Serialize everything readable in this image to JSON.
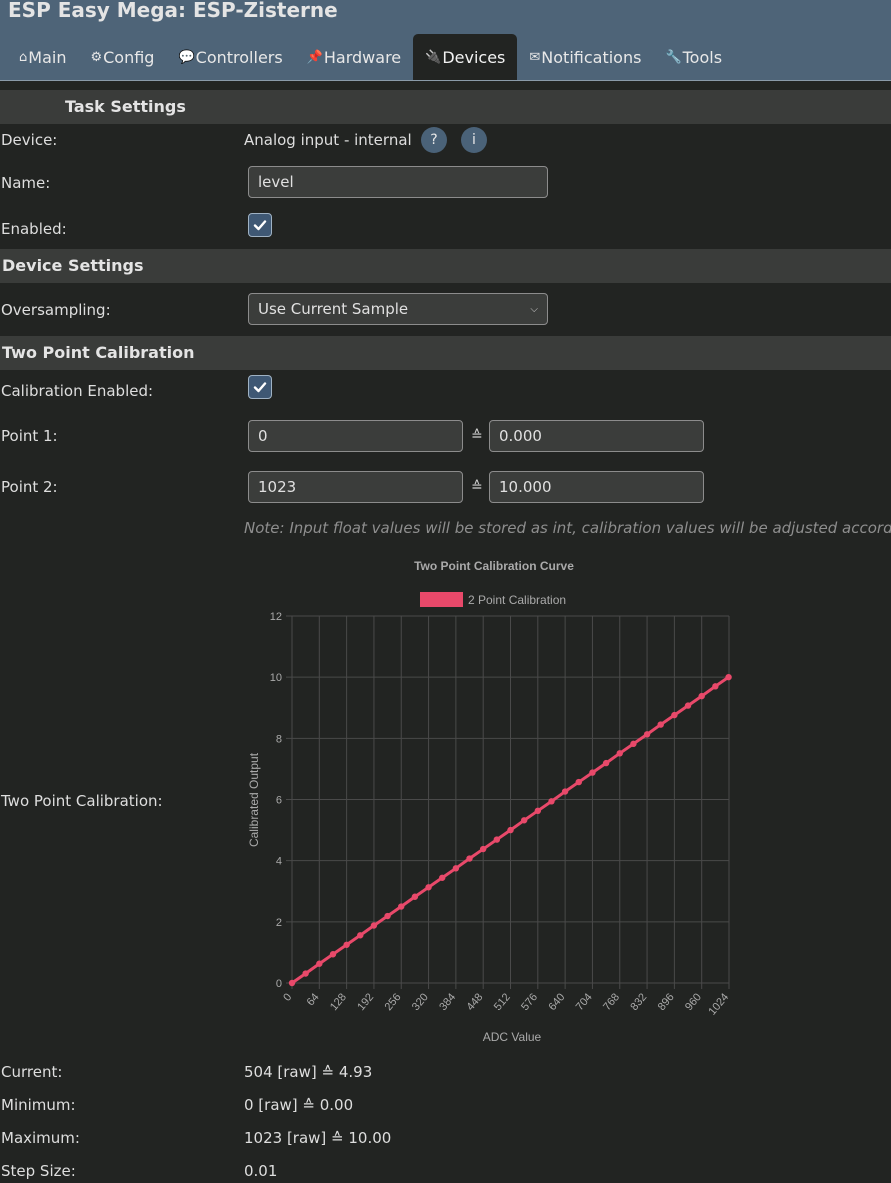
{
  "app": {
    "title": "ESP Easy Mega: ESP-Zisterne"
  },
  "tabs": [
    {
      "icon": "⌂",
      "label": "Main"
    },
    {
      "icon": "⚙",
      "label": "Config"
    },
    {
      "icon": "💬",
      "label": "Controllers"
    },
    {
      "icon": "📌",
      "label": "Hardware"
    },
    {
      "icon": "🔌",
      "label": "Devices"
    },
    {
      "icon": "✉",
      "label": "Notifications"
    },
    {
      "icon": "🔧",
      "label": "Tools"
    }
  ],
  "task_settings": {
    "heading": "Task Settings",
    "device_label": "Device:",
    "device_value": "Analog input - internal",
    "help_button": "?",
    "info_button": "i",
    "name_label": "Name:",
    "name_value": "level",
    "enabled_label": "Enabled:",
    "enabled_checked": true
  },
  "device_settings": {
    "heading": "Device Settings",
    "oversampling_label": "Oversampling:",
    "oversampling_value": "Use Current Sample"
  },
  "calibration": {
    "heading": "Two Point Calibration",
    "enabled_label": "Calibration Enabled:",
    "enabled_checked": true,
    "point1_label": "Point 1:",
    "point1_adc": "0",
    "point1_value": "0.000",
    "point2_label": "Point 2:",
    "point2_adc": "1023",
    "point2_value": "10.000",
    "equal_sign": "≙",
    "note": "Note: Input float values will be stored as int, calibration values will be adjusted accordingly",
    "chart_row_label": "Two Point Calibration:"
  },
  "chart_data": {
    "type": "line",
    "title": "Two Point Calibration Curve",
    "xlabel": "ADC Value",
    "ylabel": "Calibrated Output",
    "legend": "top",
    "grid": true,
    "x_ticks": [
      "0",
      "64",
      "128",
      "192",
      "256",
      "320",
      "384",
      "448",
      "512",
      "576",
      "640",
      "704",
      "768",
      "832",
      "896",
      "960",
      "1024"
    ],
    "y_ticks": [
      "0",
      "2",
      "4",
      "6",
      "8",
      "10",
      "12"
    ],
    "xlim": [
      0,
      1024
    ],
    "ylim": [
      0,
      12
    ],
    "series": [
      {
        "name": "2 Point Calibration",
        "color": "#e8496a",
        "x": [
          0,
          32,
          64,
          96,
          128,
          160,
          192,
          224,
          256,
          288,
          320,
          352,
          384,
          416,
          448,
          480,
          512,
          544,
          576,
          608,
          640,
          672,
          704,
          736,
          768,
          800,
          832,
          864,
          896,
          928,
          960,
          992,
          1023
        ],
        "y": [
          0,
          0.31,
          0.63,
          0.94,
          1.25,
          1.56,
          1.88,
          2.19,
          2.5,
          2.82,
          3.13,
          3.44,
          3.75,
          4.07,
          4.38,
          4.69,
          5.0,
          5.32,
          5.63,
          5.94,
          6.26,
          6.57,
          6.88,
          7.19,
          7.51,
          7.82,
          8.13,
          8.45,
          8.76,
          9.07,
          9.38,
          9.7,
          10.0
        ]
      }
    ]
  },
  "stats": {
    "current_label": "Current:",
    "current_value": "504 [raw] ≙ 4.93",
    "minimum_label": "Minimum:",
    "minimum_value": "0 [raw] ≙ 0.00",
    "maximum_label": "Maximum:",
    "maximum_value": "1023 [raw] ≙ 10.00",
    "step_label": "Step Size:",
    "step_value": "0.01"
  }
}
